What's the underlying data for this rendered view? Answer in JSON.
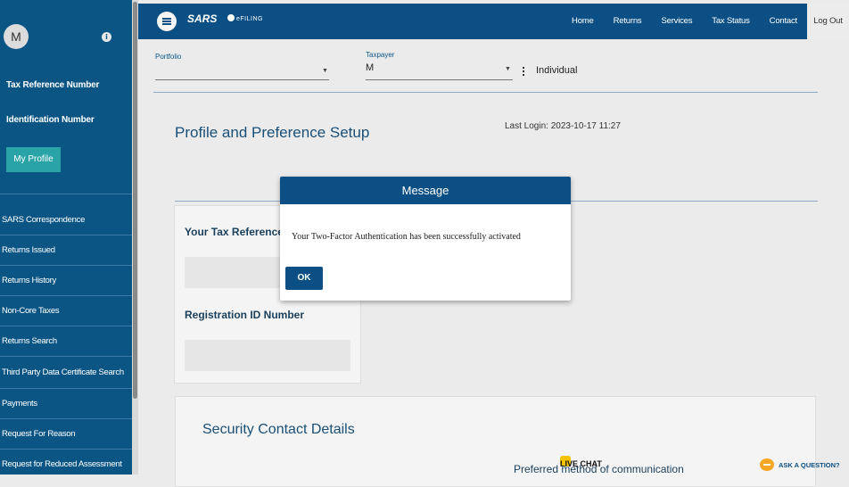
{
  "sidebar": {
    "avatar_letter": "M",
    "tax_ref_label": "Tax Reference Number",
    "id_label": "Identification Number",
    "profile_button": "My Profile",
    "menu": [
      "SARS Correspondence",
      "Returns Issued",
      "Returns History",
      "Non-Core Taxes",
      "Returns Search",
      "Third Party Data Certificate Search",
      "Payments",
      "Request For Reason",
      "Request for Reduced Assessment"
    ]
  },
  "header": {
    "logo": "SARS",
    "logo_sub": "eFILING",
    "nav": [
      "Home",
      "Returns",
      "Services",
      "Tax Status",
      "Contact",
      "Log Out"
    ]
  },
  "filters": {
    "portfolio_label": "Portfolio",
    "portfolio_value": "",
    "taxpayer_label": "Taxpayer",
    "taxpayer_value": "M",
    "taxpayer_type": "Individual"
  },
  "page": {
    "title": "Profile and Preference Setup",
    "last_login": "Last Login: 2023-10-17 11:27",
    "card1_heading": "Your Tax Reference N",
    "card2_heading": "Registration ID Number",
    "security_title": "Security Contact Details",
    "preferred": "Preferred method of communication"
  },
  "modal": {
    "title": "Message",
    "message": "Your Two-Factor Authentication has been successfully activated",
    "ok": "OK"
  },
  "bottom": {
    "live_chat": "LIVE CHAT",
    "ask": "ASK A QUESTION?"
  }
}
